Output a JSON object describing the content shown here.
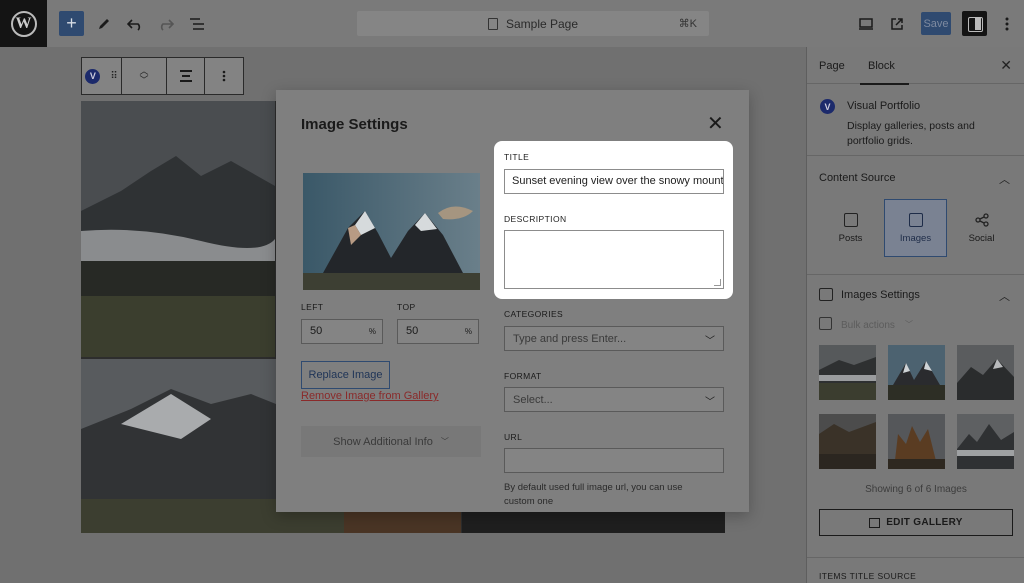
{
  "topbar": {
    "command_palette_label": "Sample Page",
    "command_shortcut": "⌘K",
    "save_label": "Save"
  },
  "sidebar": {
    "tabs": [
      "Page",
      "Block"
    ],
    "active_tab": "Block",
    "block": {
      "badge": "V",
      "name": "Visual Portfolio",
      "description": "Display galleries, posts and portfolio grids."
    },
    "content_source": {
      "title": "Content Source",
      "options": [
        {
          "label": "Posts",
          "icon": "posts-icon"
        },
        {
          "label": "Images",
          "icon": "images-icon",
          "selected": true
        },
        {
          "label": "Social",
          "icon": "share-icon"
        }
      ]
    },
    "images_settings": {
      "title": "Images Settings",
      "bulk_actions_label": "Bulk actions",
      "showing_text": "Showing 6 of 6 Images",
      "edit_gallery_label": "EDIT GALLERY"
    },
    "items_title_source_label": "ITEMS TITLE SOURCE"
  },
  "modal": {
    "title": "Image Settings",
    "left_label": "LEFT",
    "left_value": "50",
    "top_label": "TOP",
    "top_value": "50",
    "percent_unit": "%",
    "replace_image_label": "Replace Image",
    "remove_image_label": "Remove Image from Gallery",
    "show_additional_label": "Show Additional Info",
    "title_field_label": "TITLE",
    "title_field_value": "Sunset evening view over the snowy mountains",
    "description_field_label": "DESCRIPTION",
    "description_field_value": "",
    "categories_label": "CATEGORIES",
    "categories_placeholder": "Type and press Enter...",
    "format_label": "FORMAT",
    "format_value": "Select...",
    "url_label": "URL",
    "url_value": "",
    "url_help": "By default used full image url, you can use custom one"
  },
  "colors": {
    "accent": "#2f4a70",
    "overlay": "#6b6b6b",
    "highlight_card": "#ffffff"
  }
}
